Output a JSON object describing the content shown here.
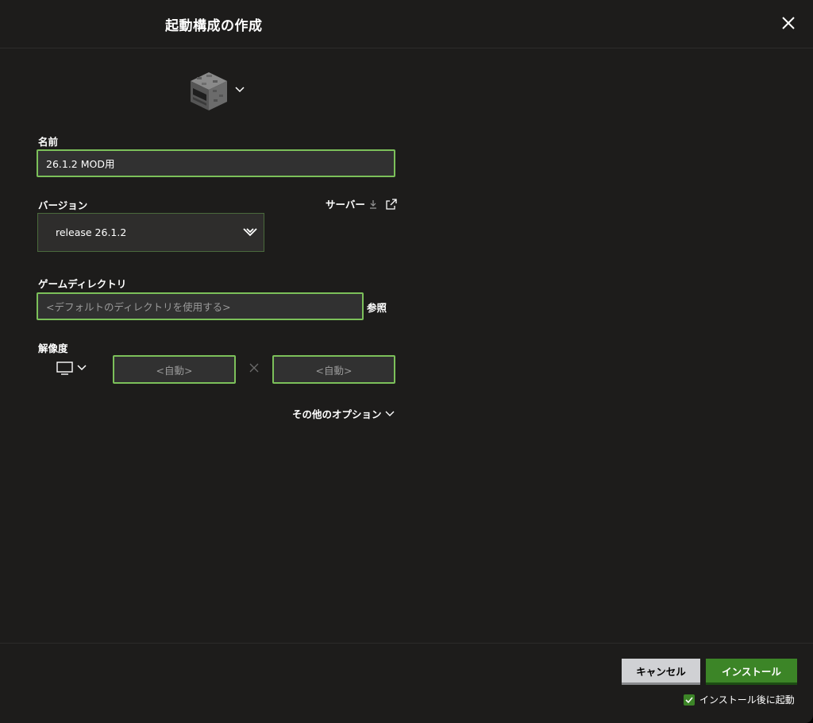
{
  "dialog": {
    "title": "起動構成の作成",
    "close_icon": "close-icon"
  },
  "icon_picker": {
    "icon": "furnace-block-icon",
    "chevron": "chevron-down-icon"
  },
  "name": {
    "label": "名前",
    "value": "26.1.2 MOD用"
  },
  "version": {
    "label": "バージョン",
    "selected": "release 26.1.2",
    "server_link": "サーバー"
  },
  "game_directory": {
    "label": "ゲームディレクトリ",
    "placeholder": "<デフォルトのディレクトリを使用する>",
    "browse_label": "参照"
  },
  "resolution": {
    "label": "解像度",
    "width_placeholder": "<自動>",
    "height_placeholder": "<自動>"
  },
  "more_options": {
    "label": "その他のオプション"
  },
  "footer": {
    "cancel_label": "キャンセル",
    "install_label": "インストール",
    "launch_after_install_label": "インストール後に起動",
    "launch_after_install_checked": true
  },
  "colors": {
    "accent_green": "#3c8527",
    "field_border": "#7cc05a",
    "background": "#1d1c1b"
  }
}
